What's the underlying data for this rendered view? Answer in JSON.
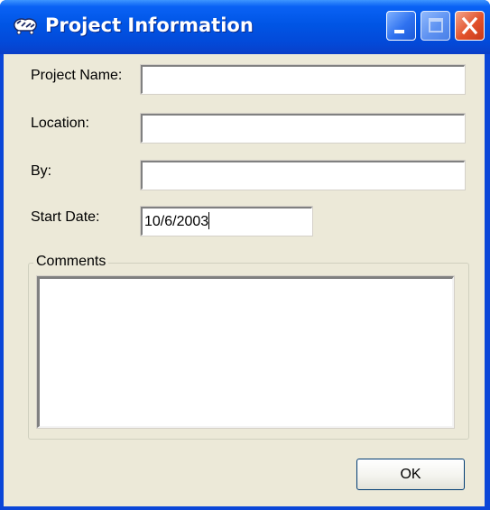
{
  "window": {
    "title": "Project Information",
    "icon": "project-app-icon",
    "controls": [
      "minimize-icon",
      "maximize-icon",
      "close-icon"
    ]
  },
  "form": {
    "project_name": {
      "label": "Project Name:",
      "value": ""
    },
    "location": {
      "label": "Location:",
      "value": ""
    },
    "by": {
      "label": "By:",
      "value": ""
    },
    "start_date": {
      "label": "Start Date:",
      "value": "10/6/2003"
    },
    "comments": {
      "label": "Comments",
      "value": ""
    }
  },
  "buttons": {
    "ok_label": "OK"
  },
  "colors": {
    "title_bar": "#0055e5",
    "dialog_face": "#ece9d8",
    "close_button": "#e2522b",
    "field_background": "#ffffff"
  }
}
